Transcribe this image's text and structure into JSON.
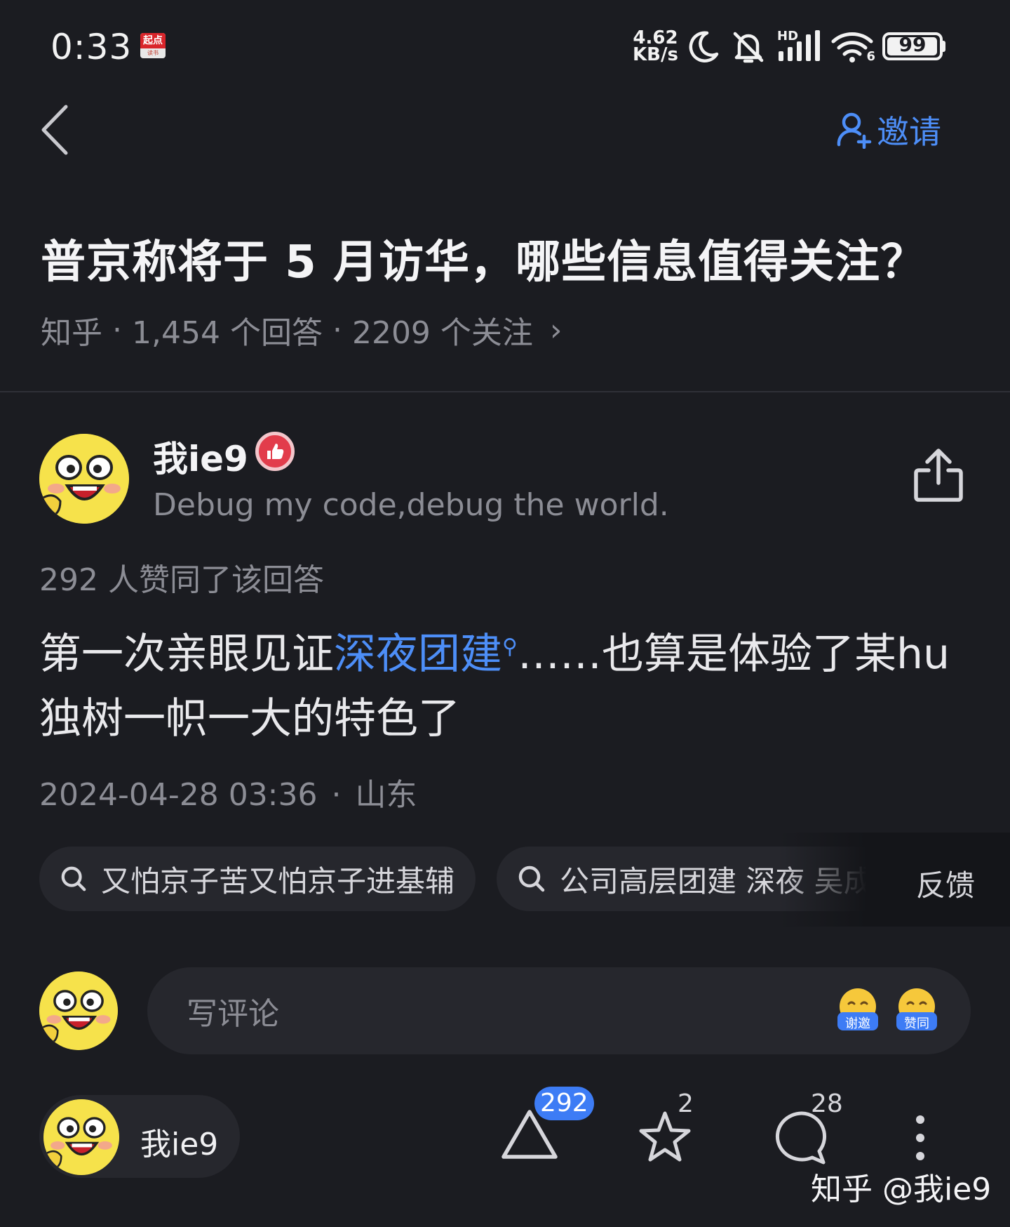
{
  "status_bar": {
    "time": "0:33",
    "app_notification_icon": "qidian-app-icon",
    "app_notification_top": "起点",
    "app_notification_bottom": "读书",
    "net_speed_value": "4.62",
    "net_speed_unit": "KB/s",
    "icons": [
      "moon-icon",
      "bell-off-icon",
      "hd-signal-icon",
      "wifi-icon"
    ],
    "hd_label": "HD",
    "wifi_label": "6",
    "battery_percent": 99
  },
  "nav": {
    "back_icon": "chevron-left-icon",
    "invite_icon": "user-add-icon",
    "invite_label": "邀请"
  },
  "question": {
    "title": "普京称将于 5 月访华，哪些信息值得关注？",
    "source": "知乎",
    "answers": "1,454 个回答",
    "followers": "2209 个关注",
    "separator": "·",
    "chevron": "›"
  },
  "answer": {
    "author_name": "我ie9",
    "author_badge_icon": "thumbs-up-badge-icon",
    "author_bio": "Debug my code,debug the world.",
    "share_icon": "share-icon",
    "vote_summary": "292 人赞同了该回答",
    "content_before": "第一次亲眼见证",
    "content_keyword": "深夜团建",
    "content_after": "……也算是体验了某hu独树一帜一大的特色了",
    "time": "2024-04-28 03:36",
    "location_separator": "·",
    "location": "山东"
  },
  "search_chips": [
    {
      "label": "又怕京子苦又怕京子进基辅",
      "icon": "search-icon"
    },
    {
      "label": "公司高层团建 深夜 吴成坤",
      "icon": "search-icon"
    }
  ],
  "feedback_label": "反馈",
  "comment": {
    "placeholder": "写评论",
    "emoji_thanks_label": "谢邀",
    "emoji_agree_label": "赞同"
  },
  "bottom_bar": {
    "author_name": "我ie9",
    "upvote_count": "292",
    "star_count": "2",
    "comment_count": "28",
    "more_icon": "more-vertical-icon"
  },
  "watermark": "知乎 @我ie9",
  "colors": {
    "background": "#1b1c21",
    "accent": "#4d8ef7",
    "badge": "#3d7cf5",
    "muted_text": "#8c8d95"
  }
}
